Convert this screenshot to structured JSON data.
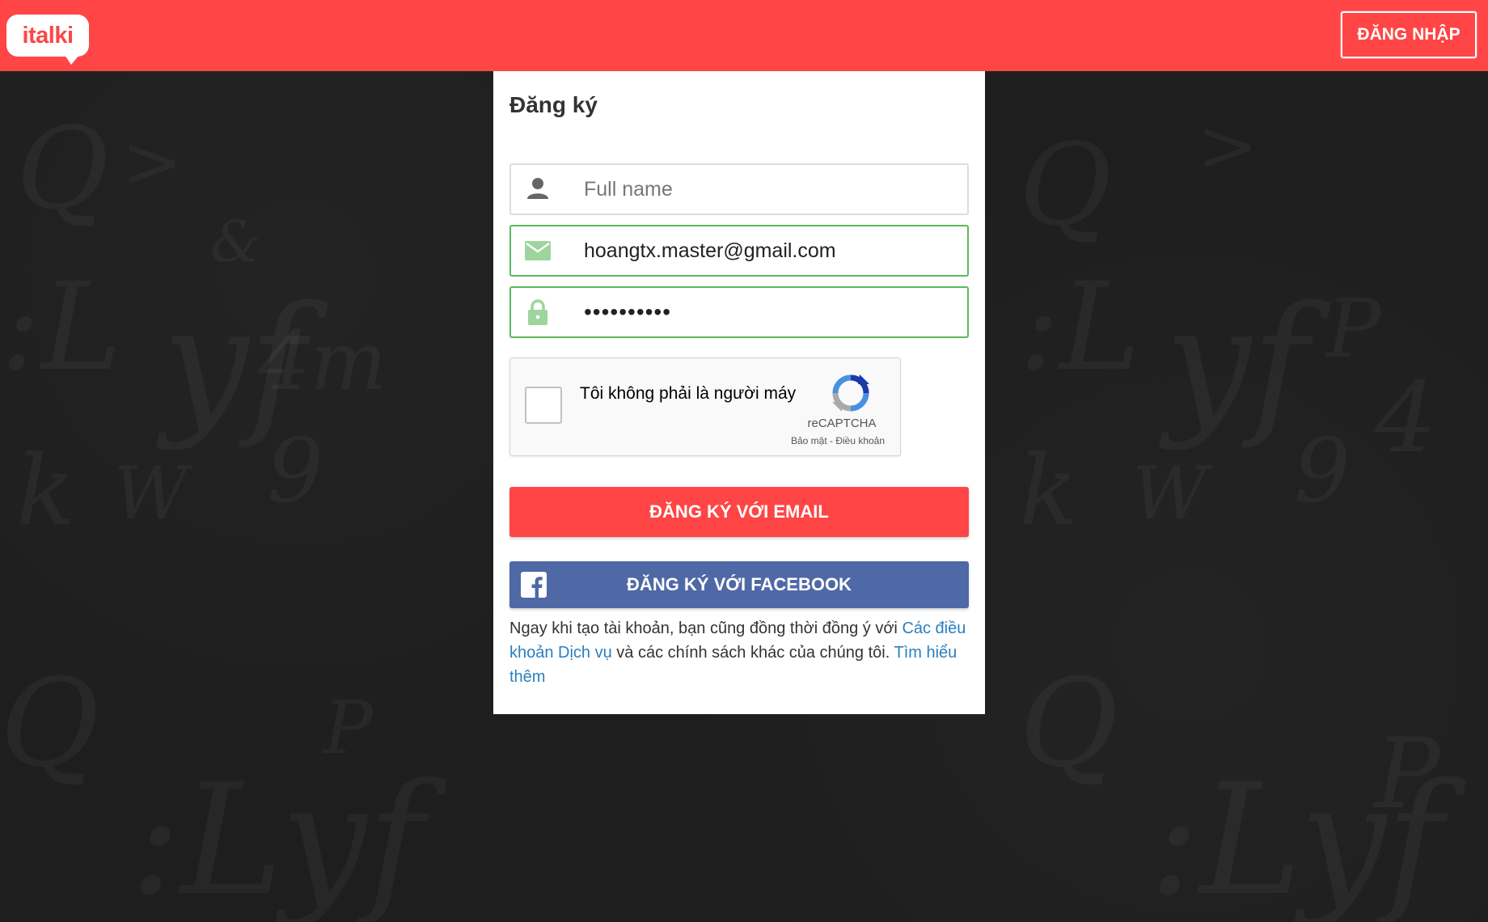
{
  "header": {
    "logo_text": "italki",
    "login_label": "ĐĂNG NHẬP"
  },
  "signup": {
    "title": "Đăng ký",
    "fullname": {
      "placeholder": "Full name",
      "value": ""
    },
    "email": {
      "value": "hoangtx.master@gmail.com"
    },
    "password": {
      "masked_value": "••••••••••"
    },
    "captcha": {
      "label": "Tôi không phải là người máy",
      "brand": "reCAPTCHA",
      "links": "Bảo mật - Điều khoản"
    },
    "email_button_label": "ĐĂNG KÝ VỚI EMAIL",
    "facebook_button_label": "ĐĂNG KÝ VỚI FACEBOOK",
    "terms": {
      "prefix": "Ngay khi tạo tài khoản, bạn cũng đồng thời đồng ý với ",
      "link1": "Các điều khoản Dịch vụ",
      "middle": " và các chính sách khác của chúng tôi. ",
      "link2": "Tìm hiểu thêm"
    }
  },
  "colors": {
    "brand_red": "#ff4545",
    "facebook_blue": "#4f68a6",
    "valid_green": "#5cb85c",
    "link_blue": "#2a7fc0",
    "background": "#1e1e1e"
  },
  "icons": {
    "fullname": "person-icon",
    "email": "envelope-icon",
    "password": "lock-icon",
    "captcha": "recaptcha-icon",
    "facebook": "facebook-icon"
  }
}
